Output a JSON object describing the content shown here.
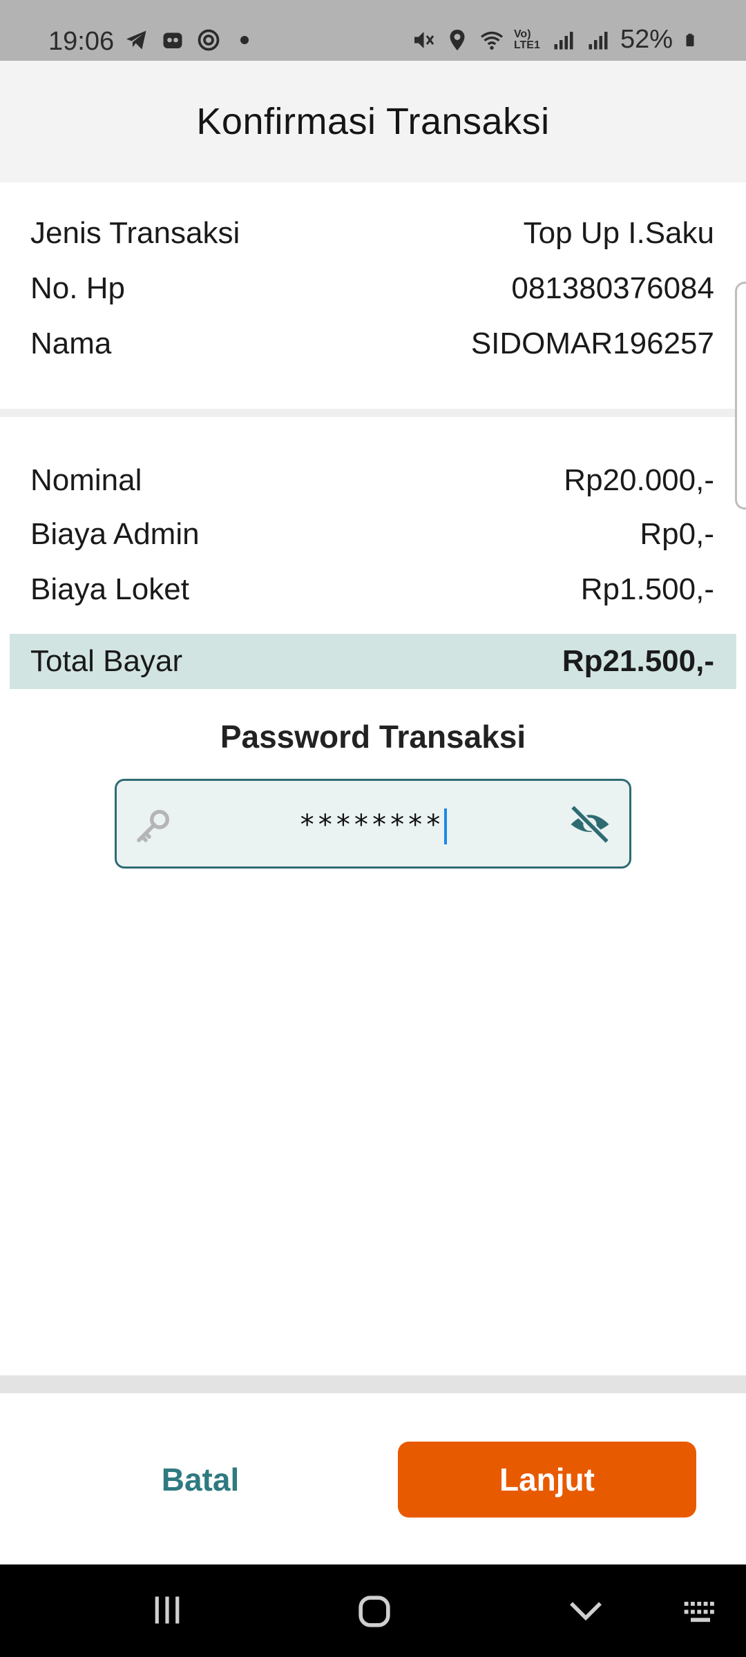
{
  "status_bar": {
    "time": "19:06",
    "battery": "52%",
    "network_label": "Vo) LTE1",
    "left_icons": [
      "telegram-icon",
      "app-icon",
      "settings-badge-icon",
      "dot-icon"
    ],
    "right_icons": [
      "mute-icon",
      "location-icon",
      "wifi-icon",
      "signal-icon",
      "signal-icon-2",
      "battery-icon"
    ]
  },
  "header": {
    "title": "Konfirmasi Transaksi"
  },
  "transaction": {
    "type_label": "Jenis Transaksi",
    "type_value": "Top Up I.Saku",
    "phone_label": "No. Hp",
    "phone_value": "081380376084",
    "name_label": "Nama",
    "name_value": "SIDOMAR196257"
  },
  "costs": {
    "nominal_label": "Nominal",
    "nominal_value": "Rp20.000,-",
    "admin_label": "Biaya Admin",
    "admin_value": "Rp0,-",
    "counter_label": "Biaya Loket",
    "counter_value": "Rp1.500,-"
  },
  "total": {
    "label": "Total Bayar",
    "value": "Rp21.500,-"
  },
  "password": {
    "title": "Password Transaksi",
    "masked_value": "********"
  },
  "actions": {
    "cancel_label": "Batal",
    "next_label": "Lanjut"
  },
  "colors": {
    "accent": "#2e7a80",
    "primary_button": "#e85a00",
    "total_bg": "#d1e4e2",
    "input_bg": "#eaf2f2"
  }
}
